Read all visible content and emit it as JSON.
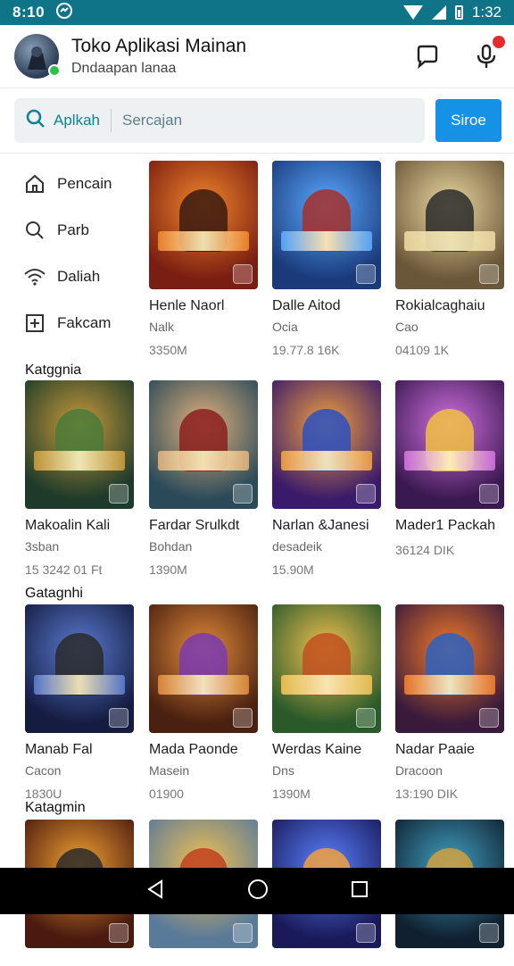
{
  "status_bar": {
    "time": "8:10",
    "clock": "1:32"
  },
  "header": {
    "title": "Toko Aplikasi Mainan",
    "subtitle": "Dndaapan lanaa"
  },
  "search": {
    "chip": "Aplkah",
    "placeholder": "Sercajan",
    "button_label": "Siroe"
  },
  "sidebar": {
    "items": [
      {
        "label": "Pencain",
        "icon": "home-icon"
      },
      {
        "label": "Parb",
        "icon": "search-icon"
      },
      {
        "label": "Daliah",
        "icon": "wifi-icon"
      },
      {
        "label": "Fakcam",
        "icon": "add-box-icon"
      }
    ]
  },
  "categories": [
    "Katggnia",
    "Gatagnhi",
    "Katagmin"
  ],
  "apps": [
    {
      "name": "Henle Naorl",
      "dev": "Nalk",
      "size": "3350M",
      "c1": "#7a1d12",
      "c2": "#f0862a",
      "c3": "#3a1a10"
    },
    {
      "name": "Dalle Aitod",
      "dev": "Ocia",
      "size": "19.77.8 16K",
      "c1": "#1a3a7a",
      "c2": "#5aa8ff",
      "c3": "#a5302a"
    },
    {
      "name": "Rokialcaghaiu",
      "dev": "Cao",
      "size": "04109 1K",
      "c1": "#6a5638",
      "c2": "#e9d7a0",
      "c3": "#2c2c2c"
    },
    {
      "name": "Makoalin Kali",
      "dev": "3sban",
      "size": "15 3242 01 Ft",
      "c1": "#1d3a2a",
      "c2": "#c89a3a",
      "c3": "#4a7a3a"
    },
    {
      "name": "Fardar Srulkdt",
      "dev": "Bohdan",
      "size": "1390M",
      "c1": "#2a4a5a",
      "c2": "#e0b07a",
      "c3": "#8a1f1f"
    },
    {
      "name": "Narlan &Janesi",
      "dev": "desadeik",
      "size": "15.90M",
      "c1": "#3a1a6a",
      "c2": "#f0a040",
      "c3": "#2a50c0"
    },
    {
      "name": "Mader1 Packah",
      "dev": "",
      "size": "36124 DIK",
      "c1": "#3a1850",
      "c2": "#d070e0",
      "c3": "#f0c040"
    },
    {
      "name": "Manab Fal",
      "dev": "Cacon",
      "size": "1830U",
      "c1": "#141c40",
      "c2": "#5a7acf",
      "c3": "#2a2a2a"
    },
    {
      "name": "Mada Paonde",
      "dev": "Masein",
      "size": "01900",
      "c1": "#4a2010",
      "c2": "#e08a3a",
      "c3": "#7a3ab0"
    },
    {
      "name": "Werdas Kaine",
      "dev": "Dns",
      "size": "1390M",
      "c1": "#2a5a2a",
      "c2": "#f0c050",
      "c3": "#c05020"
    },
    {
      "name": "Nadar Paaie",
      "dev": "Dracoon",
      "size": "13:190 DIK",
      "c1": "#3a1a3a",
      "c2": "#f07a2a",
      "c3": "#2a60c0"
    },
    {
      "name": "",
      "dev": "",
      "size": "",
      "c1": "#4a1a10",
      "c2": "#f0a030",
      "c3": "#2a2a2a"
    },
    {
      "name": "",
      "dev": "",
      "size": "",
      "c1": "#5a7a9a",
      "c2": "#f0c050",
      "c3": "#c04020"
    },
    {
      "name": "",
      "dev": "",
      "size": "",
      "c1": "#1a1a5a",
      "c2": "#5a80ff",
      "c3": "#f0a040"
    },
    {
      "name": "",
      "dev": "",
      "size": "",
      "c1": "#102030",
      "c2": "#40a0c0",
      "c3": "#d0a040"
    }
  ]
}
